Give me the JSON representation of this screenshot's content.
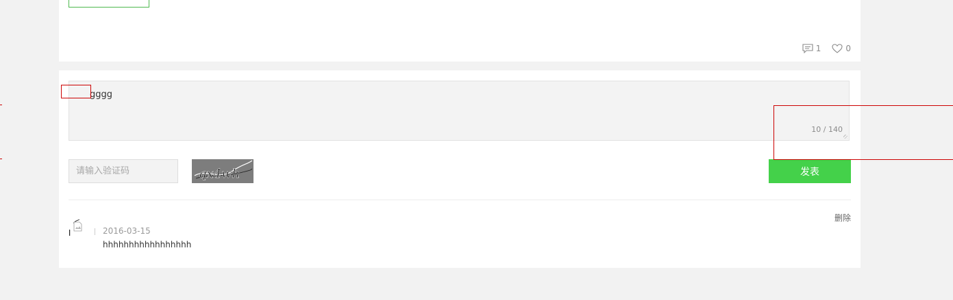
{
  "post": {
    "comment_count": "1",
    "like_count": "0"
  },
  "composer": {
    "text": "gggg",
    "char_count": "10 / 140",
    "captcha_placeholder": "请输入验证码",
    "captcha_text": "qx4wh",
    "publish_label": "发表"
  },
  "comments": [
    {
      "date": "2016-03-15",
      "body": "hhhhhhhhhhhhhhhhh",
      "delete_label": "删除"
    }
  ],
  "colors": {
    "accent_green": "#44d14a",
    "debug_red": "#cc0000"
  },
  "icons": {
    "comment": "comment-icon",
    "like": "heart-icon",
    "avatar": "broken-image-icon"
  }
}
